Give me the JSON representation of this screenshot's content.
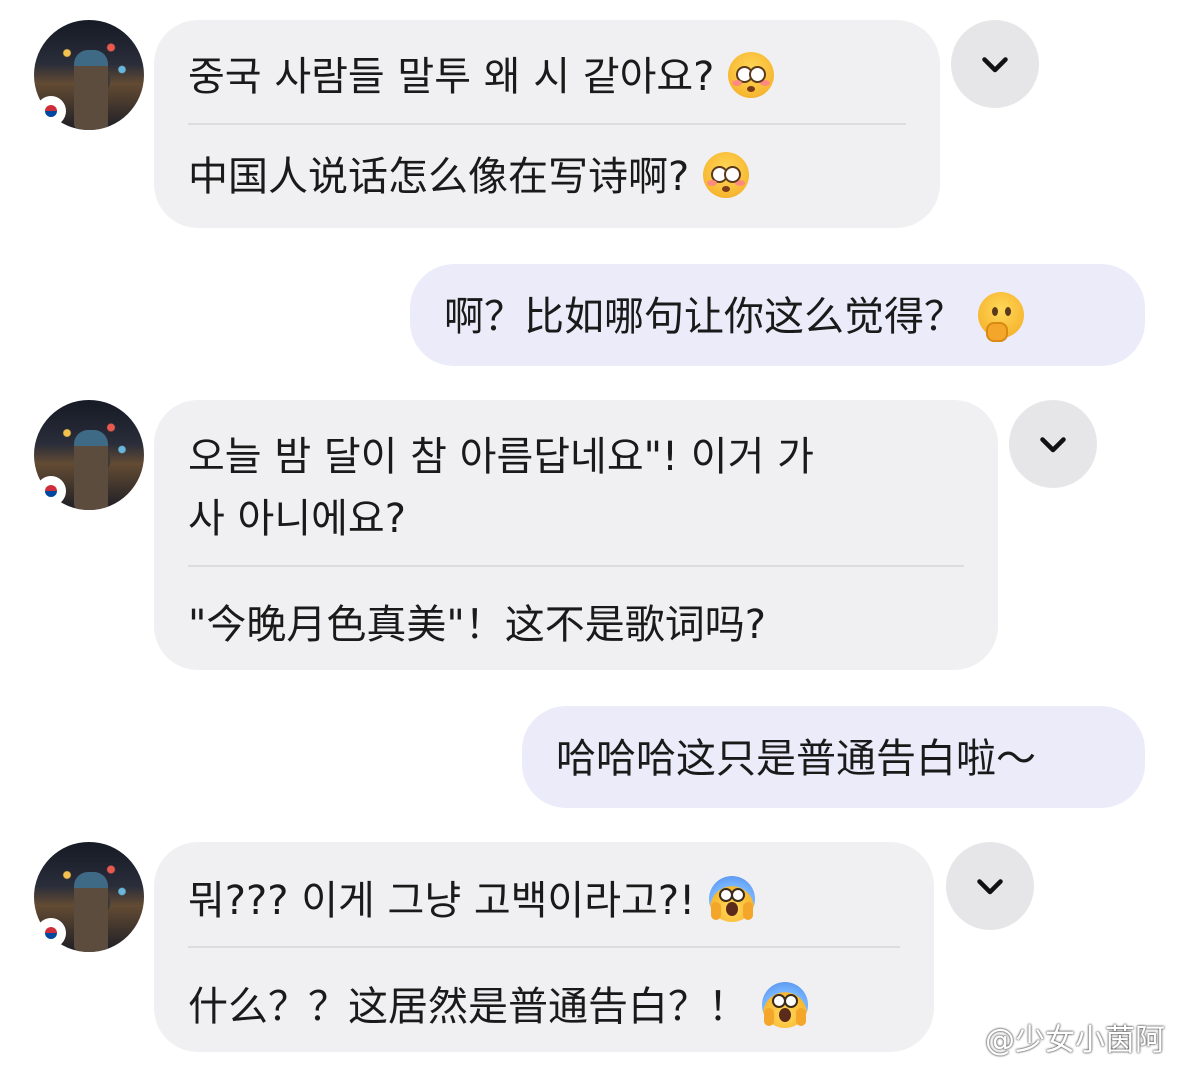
{
  "messages": [
    {
      "sender": "them",
      "korean": "중국 사람들 말투 왜 시 같아요?",
      "chinese": "中国人说话怎么像在写诗啊?",
      "emoji": "flushed-face"
    },
    {
      "sender": "me",
      "text": "啊？比如哪句让你这么觉得？",
      "emoji": "thinking-face"
    },
    {
      "sender": "them",
      "korean_lines": [
        "오늘 밤 달이 참 아름답네요\"! 이거 가",
        "사 아니에요?"
      ],
      "chinese": "\"今晚月色真美\"！这不是歌词吗?"
    },
    {
      "sender": "me",
      "text": "哈哈哈这只是普通告白啦～"
    },
    {
      "sender": "them",
      "korean": "뭐??? 이게 그냥 고백이라고?!",
      "chinese": "什么？？这居然是普通告白？！",
      "emoji": "screaming-face"
    }
  ],
  "watermark": "@少女小茵阿",
  "icons": {
    "expand": "chevron-down-icon",
    "flag": "korea-flag-icon",
    "watermark_logo": "weibo-icon"
  }
}
